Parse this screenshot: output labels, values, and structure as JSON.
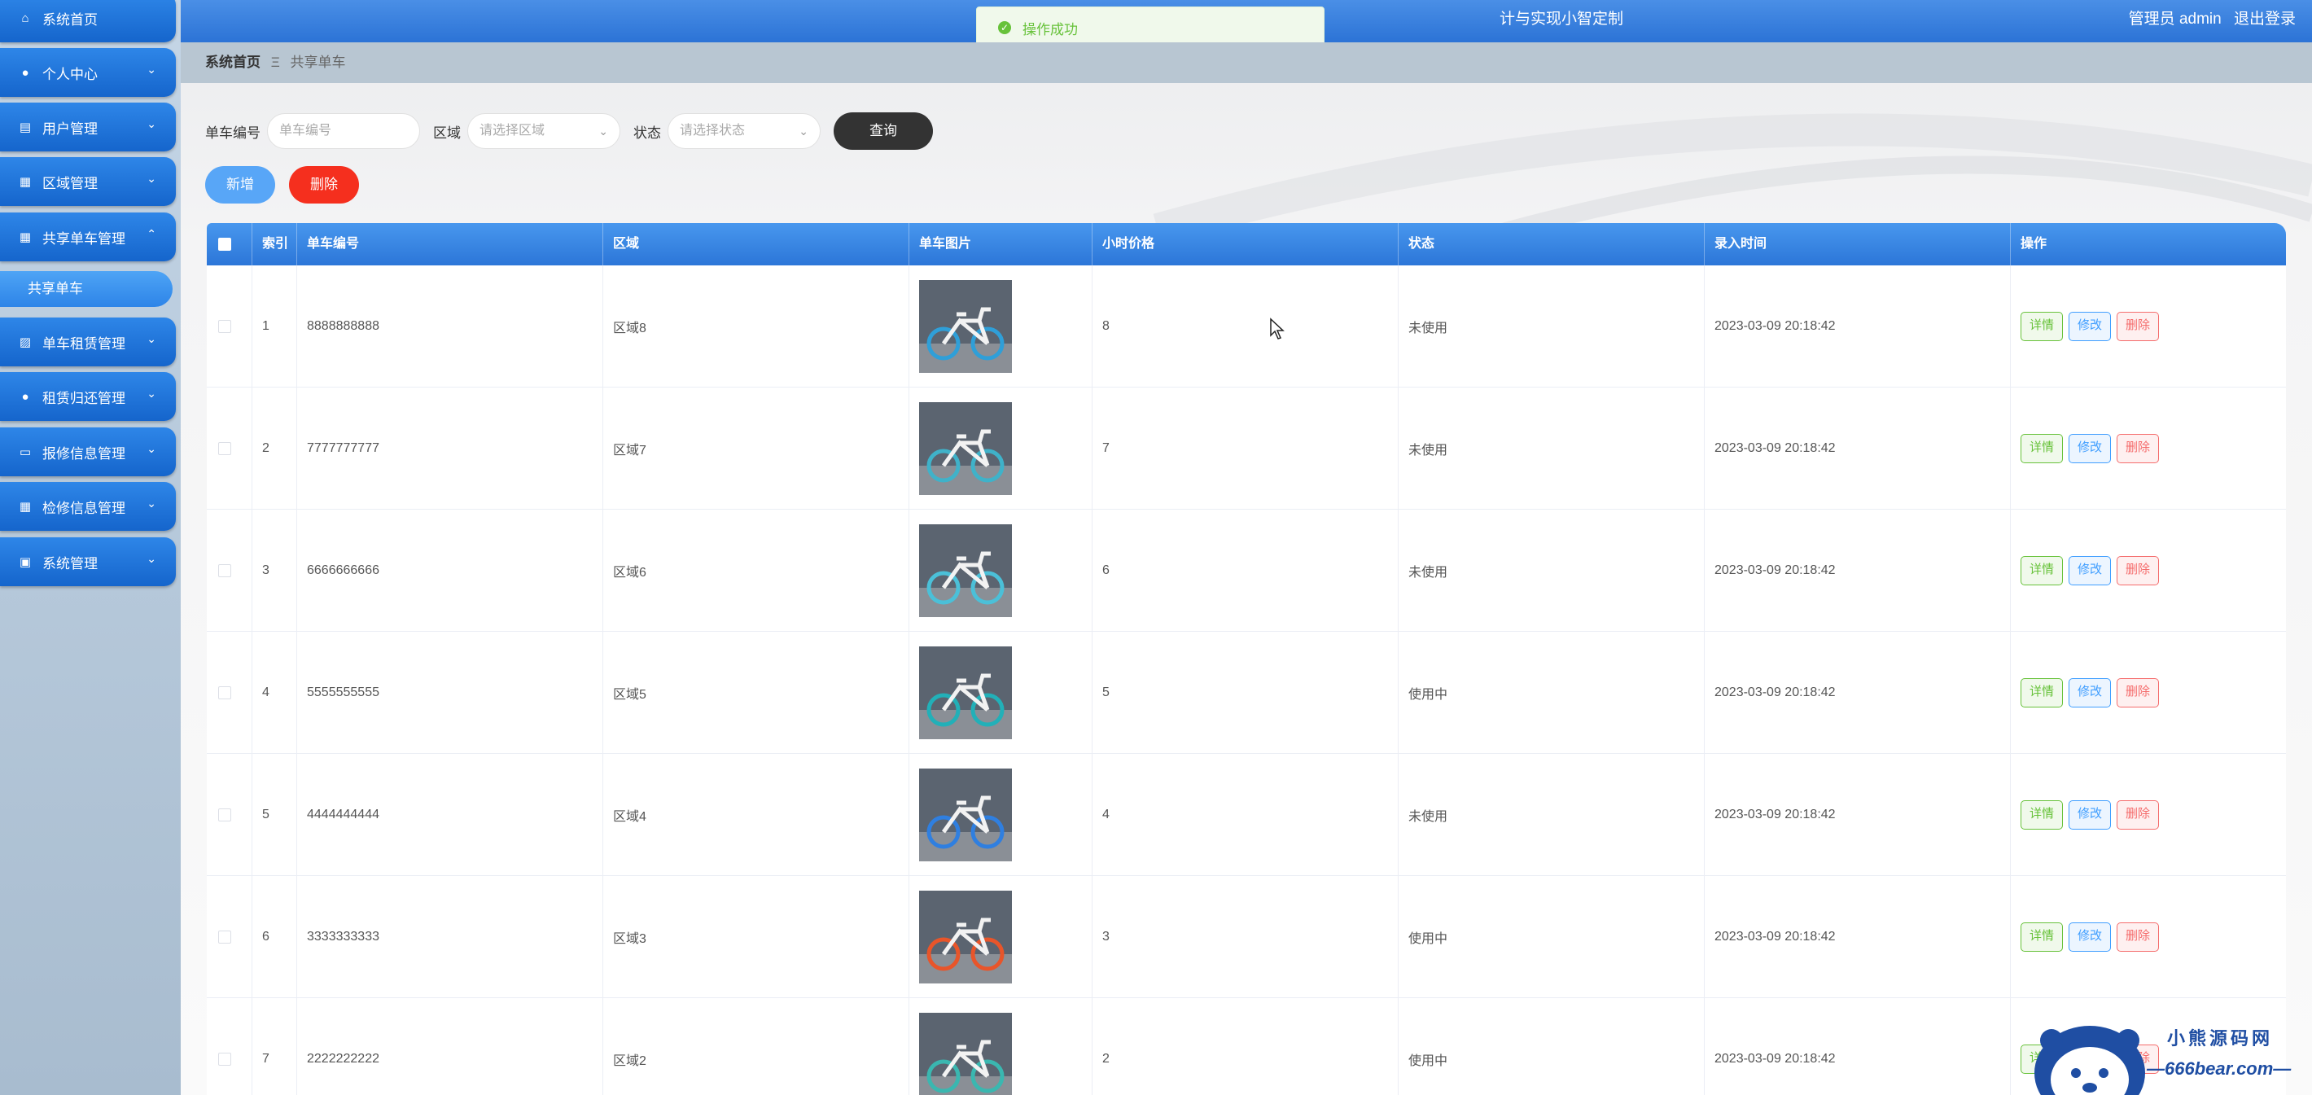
{
  "header": {
    "title": "计与实现小智定制",
    "user_label": "管理员 admin",
    "logout_label": "退出登录"
  },
  "toast": {
    "message": "操作成功"
  },
  "sidebar": {
    "items": [
      {
        "label": "系统首页",
        "icon": "home-icon"
      },
      {
        "label": "个人中心",
        "icon": "user-icon"
      },
      {
        "label": "用户管理",
        "icon": "clipboard-icon"
      },
      {
        "label": "区域管理",
        "icon": "grid-icon"
      },
      {
        "label": "共享单车管理",
        "icon": "grid-icon"
      },
      {
        "label": "单车租赁管理",
        "icon": "chart-icon"
      },
      {
        "label": "租赁归还管理",
        "icon": "user-icon"
      },
      {
        "label": "报修信息管理",
        "icon": "monitor-icon"
      },
      {
        "label": "检修信息管理",
        "icon": "grid-icon"
      },
      {
        "label": "系统管理",
        "icon": "calendar-icon"
      }
    ],
    "submenu_label": "共享单车"
  },
  "breadcrumb": {
    "home": "系统首页",
    "separator": "Ξ",
    "current": "共享单车"
  },
  "filters": {
    "bike_no_label": "单车编号",
    "bike_no_placeholder": "单车编号",
    "area_label": "区域",
    "area_placeholder": "请选择区域",
    "status_label": "状态",
    "status_placeholder": "请选择状态",
    "query_label": "查询"
  },
  "actions": {
    "add_label": "新增",
    "delete_label": "删除"
  },
  "table": {
    "headers": [
      "索引",
      "单车编号",
      "区域",
      "单车图片",
      "小时价格",
      "状态",
      "录入时间",
      "操作"
    ],
    "op_labels": {
      "detail": "详情",
      "edit": "修改",
      "remove": "删除"
    },
    "rows": [
      {
        "index": "1",
        "bike_no": "8888888888",
        "area": "区域8",
        "price": "8",
        "status": "未使用",
        "time": "2023-03-09 20:18:42",
        "img_color": "#2f9fd8"
      },
      {
        "index": "2",
        "bike_no": "7777777777",
        "area": "区域7",
        "price": "7",
        "status": "未使用",
        "time": "2023-03-09 20:18:42",
        "img_color": "#3fb2c9"
      },
      {
        "index": "3",
        "bike_no": "6666666666",
        "area": "区域6",
        "price": "6",
        "status": "未使用",
        "time": "2023-03-09 20:18:42",
        "img_color": "#4bc0d8"
      },
      {
        "index": "4",
        "bike_no": "5555555555",
        "area": "区域5",
        "price": "5",
        "status": "使用中",
        "time": "2023-03-09 20:18:42",
        "img_color": "#22b0b8"
      },
      {
        "index": "5",
        "bike_no": "4444444444",
        "area": "区域4",
        "price": "4",
        "status": "未使用",
        "time": "2023-03-09 20:18:42",
        "img_color": "#2f7fe0"
      },
      {
        "index": "6",
        "bike_no": "3333333333",
        "area": "区域3",
        "price": "3",
        "status": "使用中",
        "time": "2023-03-09 20:18:42",
        "img_color": "#e8552a"
      },
      {
        "index": "7",
        "bike_no": "2222222222",
        "area": "区域2",
        "price": "2",
        "status": "使用中",
        "time": "2023-03-09 20:18:42",
        "img_color": "#3ab7b0"
      }
    ]
  },
  "watermark": {
    "line1": "小熊源码网",
    "line2": "—666bear.com—"
  }
}
